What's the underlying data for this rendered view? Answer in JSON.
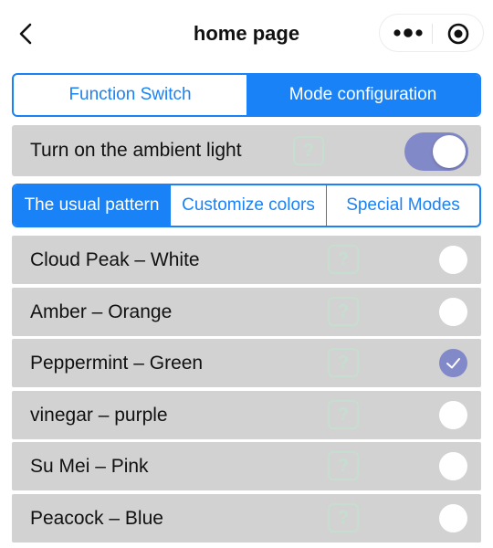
{
  "header": {
    "title": "home page",
    "back_icon": "chevron-left-icon",
    "more_icon": "more-dots-icon",
    "close_icon": "target-circle-icon"
  },
  "tabs_top": [
    {
      "label": "Function Switch",
      "active": false
    },
    {
      "label": "Mode configuration",
      "active": true
    }
  ],
  "ambient": {
    "label": "Turn on the ambient light",
    "help": "?",
    "toggle_on": true
  },
  "tabs_mid": [
    {
      "label": "The usual pattern",
      "active": true
    },
    {
      "label": "Customize colors",
      "active": false
    },
    {
      "label": "Special Modes",
      "active": false
    }
  ],
  "modes": [
    {
      "name": "Cloud Peak – White",
      "help": "?",
      "selected": false
    },
    {
      "name": "Amber – Orange",
      "help": "?",
      "selected": false
    },
    {
      "name": "Peppermint – Green",
      "help": "?",
      "selected": true
    },
    {
      "name": "vinegar – purple",
      "help": "?",
      "selected": false
    },
    {
      "name": "Su Mei – Pink",
      "help": "?",
      "selected": false
    },
    {
      "name": "Peacock – Blue",
      "help": "?",
      "selected": false
    }
  ],
  "colors": {
    "accent": "#1a82f7",
    "toggle_and_check": "#8289c8",
    "row_background": "#d2d2d2",
    "help_icon": "#c6ded0"
  }
}
